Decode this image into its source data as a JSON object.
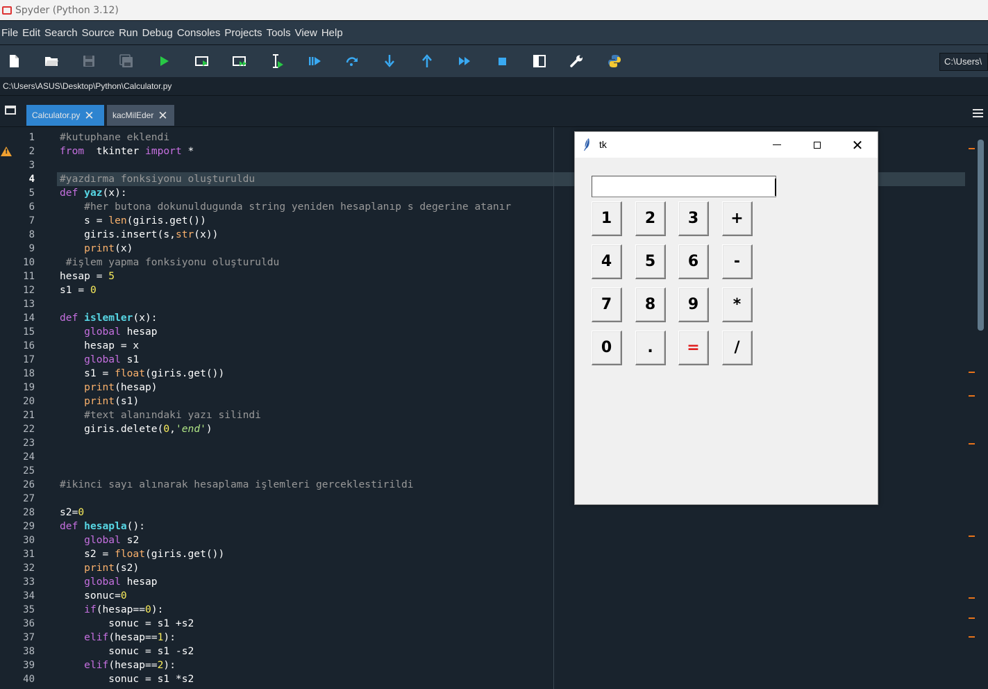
{
  "window": {
    "title": "Spyder (Python 3.12)"
  },
  "menu": [
    "File",
    "Edit",
    "Search",
    "Source",
    "Run",
    "Debug",
    "Consoles",
    "Projects",
    "Tools",
    "View",
    "Help"
  ],
  "toolbar": {
    "icons": [
      "new-file-icon",
      "open-folder-icon",
      "save-icon",
      "save-all-icon",
      "run-icon",
      "run-cell-icon",
      "run-cell-advance-icon",
      "run-selection-icon",
      "debug-icon",
      "step-over-icon",
      "step-into-icon",
      "step-return-icon",
      "continue-icon",
      "stop-icon",
      "maximize-pane-icon",
      "preferences-wrench-icon",
      "python-path-icon"
    ],
    "working_dir": "C:\\Users\\"
  },
  "file_path": "C:\\Users\\ASUS\\Desktop\\Python\\Calculator.py",
  "tabs": [
    {
      "label": "Calculator.py",
      "active": true
    },
    {
      "label": "kacMilEder",
      "active": false
    }
  ],
  "editor": {
    "current_line": 4,
    "warning_line": 2,
    "line_numbers": [
      "1",
      "2",
      "3",
      "4",
      "5",
      "6",
      "7",
      "8",
      "9",
      "10",
      "11",
      "12",
      "13",
      "14",
      "15",
      "16",
      "17",
      "18",
      "19",
      "20",
      "21",
      "22",
      "23",
      "24",
      "25",
      "26",
      "27",
      "28",
      "29",
      "30",
      "31",
      "32",
      "33",
      "34",
      "35",
      "36",
      "37",
      "38",
      "39",
      "40"
    ],
    "lines": [
      [
        [
          "c-com",
          "#kutuphane eklendi"
        ]
      ],
      [
        [
          "c-kw",
          "from"
        ],
        [
          "",
          "  tkinter "
        ],
        [
          "c-kw",
          "import"
        ],
        [
          "",
          " *"
        ]
      ],
      [],
      [
        [
          "c-com",
          "#yazdırma fonksiyonu oluşturuldu"
        ]
      ],
      [
        [
          "c-kw",
          "def"
        ],
        [
          "",
          " "
        ],
        [
          "c-fn",
          "yaz"
        ],
        [
          "",
          "(x):"
        ]
      ],
      [
        [
          "",
          "    "
        ],
        [
          "c-com",
          "#her butona dokunuldugunda string yeniden hesaplanıp s degerine atanır"
        ]
      ],
      [
        [
          "",
          "    s = "
        ],
        [
          "c-bi",
          "len"
        ],
        [
          "",
          "(giris.get())"
        ]
      ],
      [
        [
          "",
          "    giris.insert(s,"
        ],
        [
          "c-bi",
          "str"
        ],
        [
          "",
          "(x))"
        ]
      ],
      [
        [
          "",
          "    "
        ],
        [
          "c-bi",
          "print"
        ],
        [
          "",
          "(x)"
        ]
      ],
      [
        [
          "",
          " "
        ],
        [
          "c-com",
          "#işlem yapma fonksiyonu oluşturuldu"
        ]
      ],
      [
        [
          "",
          "hesap = "
        ],
        [
          "c-num",
          "5"
        ]
      ],
      [
        [
          "",
          "s1 = "
        ],
        [
          "c-num",
          "0"
        ]
      ],
      [],
      [
        [
          "c-kw",
          "def"
        ],
        [
          "",
          " "
        ],
        [
          "c-fn",
          "islemler"
        ],
        [
          "",
          "(x):"
        ]
      ],
      [
        [
          "",
          "    "
        ],
        [
          "c-kw",
          "global"
        ],
        [
          "",
          " hesap"
        ]
      ],
      [
        [
          "",
          "    hesap = x"
        ]
      ],
      [
        [
          "",
          "    "
        ],
        [
          "c-kw",
          "global"
        ],
        [
          "",
          " s1"
        ]
      ],
      [
        [
          "",
          "    s1 = "
        ],
        [
          "c-bi",
          "float"
        ],
        [
          "",
          "(giris.get())"
        ]
      ],
      [
        [
          "",
          "    "
        ],
        [
          "c-bi",
          "print"
        ],
        [
          "",
          "(hesap)"
        ]
      ],
      [
        [
          "",
          "    "
        ],
        [
          "c-bi",
          "print"
        ],
        [
          "",
          "(s1)"
        ]
      ],
      [
        [
          "",
          "    "
        ],
        [
          "c-com",
          "#text alanındaki yazı silindi"
        ]
      ],
      [
        [
          "",
          "    giris.delete("
        ],
        [
          "c-num",
          "0"
        ],
        [
          "",
          ","
        ],
        [
          "c-str",
          "'end'"
        ],
        [
          "",
          ")"
        ]
      ],
      [],
      [],
      [],
      [
        [
          "c-com",
          "#ikinci sayı alınarak hesaplama işlemleri gerceklestirildi"
        ]
      ],
      [],
      [
        [
          "",
          "s2="
        ],
        [
          "c-num",
          "0"
        ]
      ],
      [
        [
          "c-kw",
          "def"
        ],
        [
          "",
          " "
        ],
        [
          "c-fn",
          "hesapla"
        ],
        [
          "",
          "():"
        ]
      ],
      [
        [
          "",
          "    "
        ],
        [
          "c-kw",
          "global"
        ],
        [
          "",
          " s2"
        ]
      ],
      [
        [
          "",
          "    s2 = "
        ],
        [
          "c-bi",
          "float"
        ],
        [
          "",
          "(giris.get())"
        ]
      ],
      [
        [
          "",
          "    "
        ],
        [
          "c-bi",
          "print"
        ],
        [
          "",
          "(s2)"
        ]
      ],
      [
        [
          "",
          "    "
        ],
        [
          "c-kw",
          "global"
        ],
        [
          "",
          " hesap"
        ]
      ],
      [
        [
          "",
          "    sonuc="
        ],
        [
          "c-num",
          "0"
        ]
      ],
      [
        [
          "",
          "    "
        ],
        [
          "c-kw",
          "if"
        ],
        [
          "",
          "(hesap=="
        ],
        [
          "c-num",
          "0"
        ],
        [
          "",
          "):"
        ]
      ],
      [
        [
          "",
          "        sonuc = s1 +s2"
        ]
      ],
      [
        [
          "",
          "    "
        ],
        [
          "c-kw",
          "elif"
        ],
        [
          "",
          "(hesap=="
        ],
        [
          "c-num",
          "1"
        ],
        [
          "",
          "):"
        ]
      ],
      [
        [
          "",
          "        sonuc = s1 -s2"
        ]
      ],
      [
        [
          "",
          "    "
        ],
        [
          "c-kw",
          "elif"
        ],
        [
          "",
          "(hesap=="
        ],
        [
          "c-num",
          "2"
        ],
        [
          "",
          "):"
        ]
      ],
      [
        [
          "",
          "        sonuc = s1 *s2"
        ]
      ]
    ]
  },
  "tk_window": {
    "title": "tk",
    "entry_value": "",
    "buttons": [
      "1",
      "2",
      "3",
      "+",
      "4",
      "5",
      "6",
      "-",
      "7",
      "8",
      "9",
      "*",
      "0",
      ".",
      "=",
      "/"
    ]
  },
  "colors": {
    "accent_tab": "#2e84d0",
    "run_blue": "#39a9f2",
    "equals_red": "#e01e1e",
    "warning_orange": "#f0a030"
  }
}
